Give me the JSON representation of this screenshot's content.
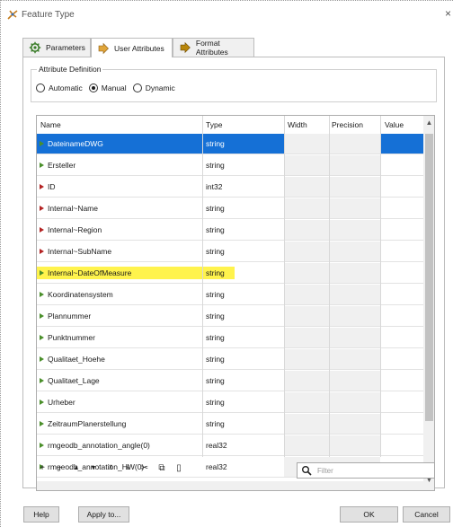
{
  "window": {
    "title": "Feature Type",
    "close_glyph": "×"
  },
  "tabs": [
    {
      "label": "Parameters",
      "icon": "gear-icon"
    },
    {
      "label": "User Attributes",
      "icon": "arrow-right-icon"
    },
    {
      "label": "Format Attributes",
      "icon": "arrow-right-icon"
    }
  ],
  "attribute_definition": {
    "title": "Attribute Definition",
    "options": [
      "Automatic",
      "Manual",
      "Dynamic"
    ],
    "selected": "Manual"
  },
  "table": {
    "columns": [
      "Name",
      "Type",
      "Width",
      "Precision",
      "Value"
    ],
    "rows": [
      {
        "name": "DateinameDWG",
        "type": "string",
        "marker": "green",
        "selected": true
      },
      {
        "name": "Ersteller",
        "type": "string",
        "marker": "green"
      },
      {
        "name": "ID",
        "type": "int32",
        "marker": "red"
      },
      {
        "name": "Internal~Name",
        "type": "string",
        "marker": "red"
      },
      {
        "name": "Internal~Region",
        "type": "string",
        "marker": "red"
      },
      {
        "name": "Internal~SubName",
        "type": "string",
        "marker": "red"
      },
      {
        "name": "Internal~DateOfMeasure",
        "type": "string",
        "marker": "green",
        "highlighted": true
      },
      {
        "name": "Koordinatensystem",
        "type": "string",
        "marker": "green"
      },
      {
        "name": "Plannummer",
        "type": "string",
        "marker": "green"
      },
      {
        "name": "Punktnummer",
        "type": "string",
        "marker": "green"
      },
      {
        "name": "Qualitaet_Hoehe",
        "type": "string",
        "marker": "green"
      },
      {
        "name": "Qualitaet_Lage",
        "type": "string",
        "marker": "green"
      },
      {
        "name": "Urheber",
        "type": "string",
        "marker": "green"
      },
      {
        "name": "ZeitraumPlanerstellung",
        "type": "string",
        "marker": "green"
      },
      {
        "name": "rmgeodb_annotation_angle(0)",
        "type": "real32",
        "marker": "green"
      },
      {
        "name": "rmgeodb_annotation_HW(0)",
        "type": "real32",
        "marker": "green"
      }
    ]
  },
  "toolbar": {
    "tools": [
      {
        "name": "add-icon",
        "glyph": "+"
      },
      {
        "name": "remove-icon",
        "glyph": "−"
      },
      {
        "name": "move-up-icon",
        "glyph": "▲"
      },
      {
        "name": "move-down-icon",
        "glyph": "▼"
      },
      {
        "name": "move-top-icon",
        "glyph": "⊼"
      },
      {
        "name": "move-bottom-icon",
        "glyph": "⊻"
      },
      {
        "name": "cut-icon",
        "glyph": "✂"
      },
      {
        "name": "copy-icon",
        "glyph": "⧉"
      },
      {
        "name": "paste-icon",
        "glyph": "▯"
      }
    ]
  },
  "filter": {
    "placeholder": "Filter"
  },
  "buttons": {
    "help": "Help",
    "apply_to": "Apply to...",
    "ok": "OK",
    "cancel": "Cancel"
  },
  "colors": {
    "selection": "#1570d6",
    "highlight": "#fff23a",
    "marker_green": "#4a8f2a",
    "marker_red": "#b42323"
  }
}
